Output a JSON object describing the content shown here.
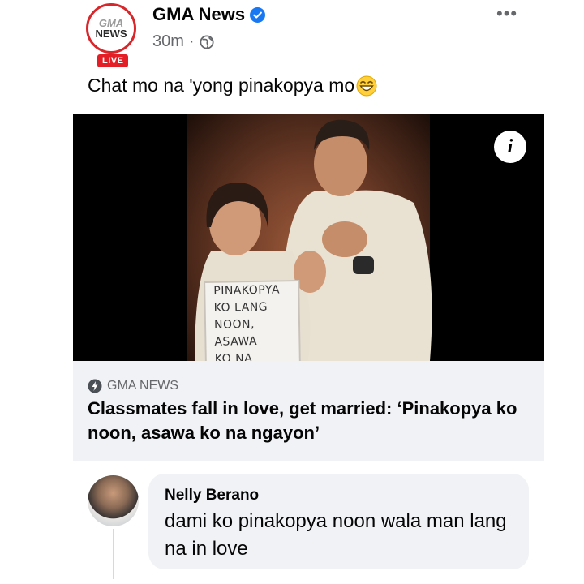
{
  "post": {
    "page_name": "GMA News",
    "logo_text_1": "GMA",
    "logo_text_2": "NEWS",
    "live_label": "LIVE",
    "timestamp": "30m",
    "separator": "·",
    "privacy_icon": "globe-icon",
    "more_label": "•••",
    "caption": "Chat mo na 'yong pinakopya mo",
    "caption_emoji": "grinning-face-icon"
  },
  "photo": {
    "info_label": "i",
    "sign_lines": [
      "PINAKOPYA",
      "KO LANG",
      "NOON, ASAWA",
      "KO NA NGAYON!"
    ]
  },
  "link": {
    "source": "GMA NEWS",
    "title": "Classmates fall in love, get married: ‘Pinakopya ko noon, asawa ko na ngayon’"
  },
  "comment": {
    "author": "Nelly Berano",
    "text": "dami ko pinakopya noon wala man lang na in love"
  },
  "colors": {
    "live_red": "#e41e26",
    "verified_blue": "#1877f2",
    "bubble_bg": "#f0f2f5",
    "meta_gray": "#65676b"
  }
}
